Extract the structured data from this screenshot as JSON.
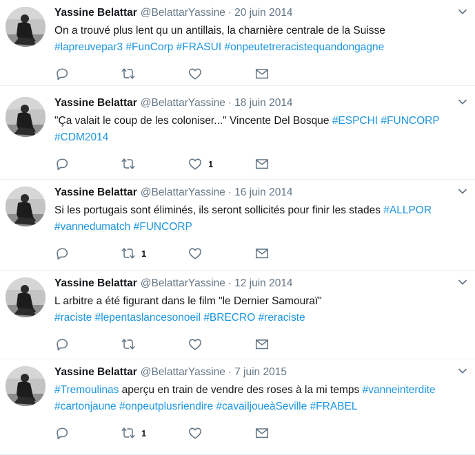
{
  "tweets": [
    {
      "name": "Yassine Belattar",
      "handle": "@BelattarYassine",
      "sep": "·",
      "date": "20 juin 2014",
      "lines": [
        [
          {
            "t": "On a trouvé plus lent qu un antillais, la charnière centrale de la Suisse"
          }
        ],
        [
          {
            "t": "#lapreuvepar3",
            "tag": true
          },
          {
            "t": " "
          },
          {
            "t": "#FunCorp",
            "tag": true
          },
          {
            "t": " "
          },
          {
            "t": "#FRASUI",
            "tag": true
          },
          {
            "t": " "
          },
          {
            "t": "#onpeutetreracistequandongagne",
            "tag": true
          }
        ]
      ],
      "retweets": "",
      "likes": ""
    },
    {
      "name": "Yassine Belattar",
      "handle": "@BelattarYassine",
      "sep": "·",
      "date": "18 juin 2014",
      "lines": [
        [
          {
            "t": "\"Ça valait le coup de les coloniser...\" Vincente Del Bosque "
          },
          {
            "t": "#ESPCHI",
            "tag": true
          },
          {
            "t": " "
          },
          {
            "t": "#FUNCORP",
            "tag": true
          }
        ],
        [
          {
            "t": "#CDM2014",
            "tag": true
          }
        ]
      ],
      "retweets": "",
      "likes": "1"
    },
    {
      "name": "Yassine Belattar",
      "handle": "@BelattarYassine",
      "sep": "·",
      "date": "16 juin 2014",
      "lines": [
        [
          {
            "t": "Si les portugais sont éliminés, ils seront sollicités pour finir les stades "
          },
          {
            "t": "#ALLPOR",
            "tag": true
          }
        ],
        [
          {
            "t": "#vannedumatch",
            "tag": true
          },
          {
            "t": " "
          },
          {
            "t": "#FUNCORP",
            "tag": true
          }
        ]
      ],
      "retweets": "1",
      "likes": ""
    },
    {
      "name": "Yassine Belattar",
      "handle": "@BelattarYassine",
      "sep": "·",
      "date": "12 juin 2014",
      "lines": [
        [
          {
            "t": "L arbitre a été figurant dans le film \"le Dernier Samouraï\""
          }
        ],
        [
          {
            "t": "#raciste",
            "tag": true
          },
          {
            "t": " "
          },
          {
            "t": "#lepentaslancesonoeil",
            "tag": true
          },
          {
            "t": " "
          },
          {
            "t": "#BRECRO",
            "tag": true
          },
          {
            "t": " "
          },
          {
            "t": "#reraciste",
            "tag": true
          }
        ]
      ],
      "retweets": "",
      "likes": ""
    },
    {
      "name": "Yassine Belattar",
      "handle": "@BelattarYassine",
      "sep": "·",
      "date": "7 juin 2015",
      "lines": [
        [
          {
            "t": "#Tremoulinas",
            "tag": true
          },
          {
            "t": " aperçu en train de vendre des roses à la mi temps "
          },
          {
            "t": "#vanneinterdite",
            "tag": true
          }
        ],
        [
          {
            "t": "#cartonjaune",
            "tag": true
          },
          {
            "t": " "
          },
          {
            "t": "#onpeutplusriendire",
            "tag": true
          },
          {
            "t": " "
          },
          {
            "t": "#cavailjoueàSeville",
            "tag": true
          },
          {
            "t": " "
          },
          {
            "t": "#FRABEL",
            "tag": true
          }
        ]
      ],
      "retweets": "1",
      "likes": ""
    }
  ],
  "icons": {
    "reply": "reply-icon",
    "retweet": "retweet-icon",
    "like": "heart-icon",
    "dm": "envelope-icon",
    "caret": "chevron-down-icon",
    "avatar": "avatar"
  },
  "colors": {
    "hashtag": "#1b95e0",
    "muted": "#657786",
    "text": "#14171a",
    "divider": "#e6ecf0"
  }
}
